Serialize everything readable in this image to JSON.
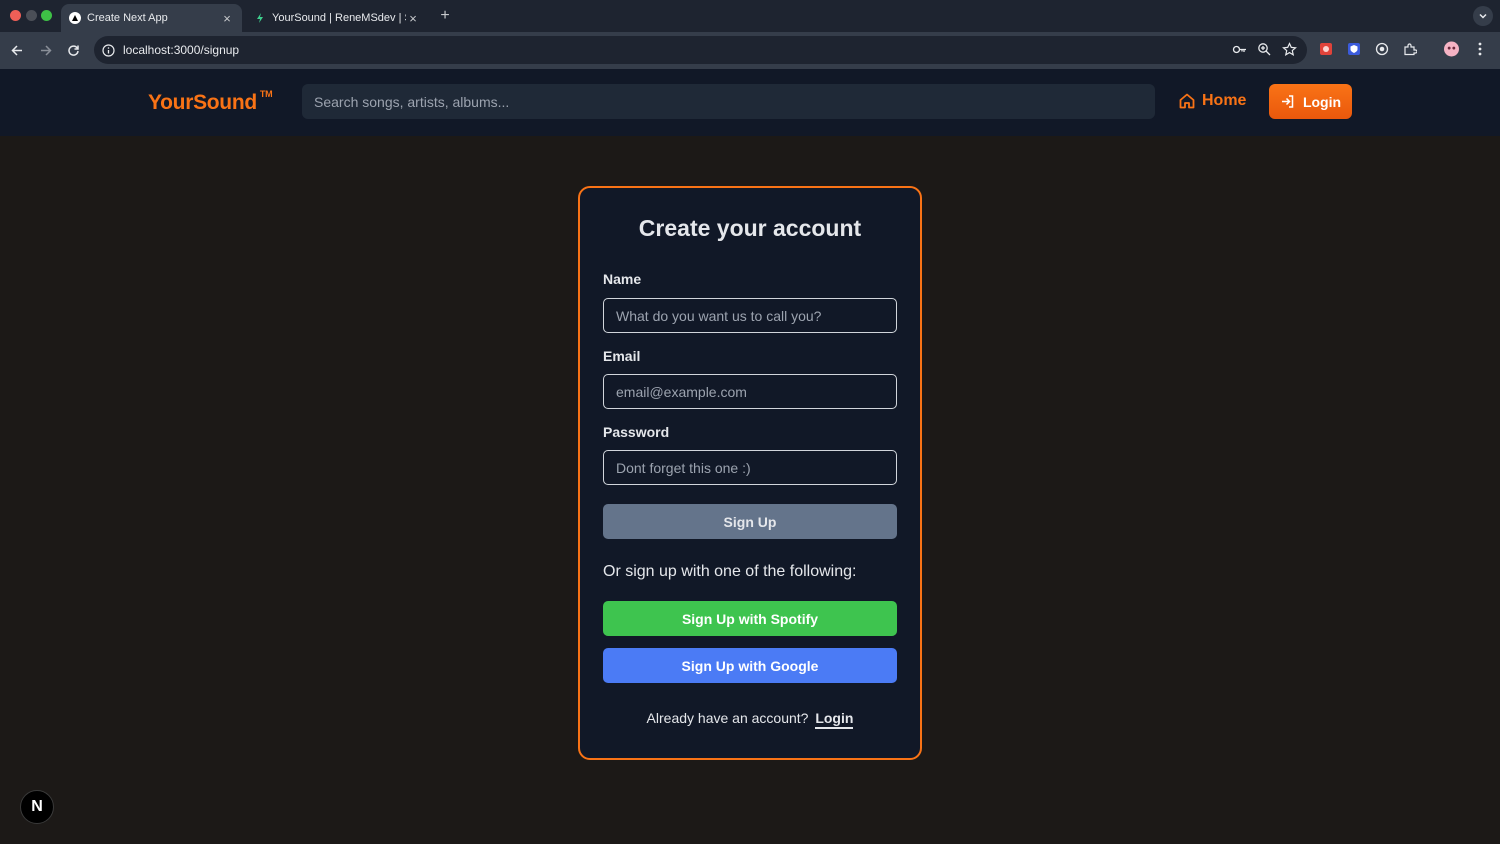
{
  "browser": {
    "tabs": [
      {
        "title": "Create Next App",
        "active": true
      },
      {
        "title": "YourSound | ReneMSdev | Su",
        "active": false
      }
    ],
    "close_glyph": "×",
    "newtab_glyph": "+",
    "url": "localhost:3000/signup"
  },
  "header": {
    "logo": "YourSound",
    "logo_tm": "TM",
    "search_placeholder": "Search songs, artists, albums...",
    "home_label": "Home",
    "login_label": "Login"
  },
  "signup": {
    "title": "Create your account",
    "name_label": "Name",
    "name_placeholder": "What do you want us to call you?",
    "email_label": "Email",
    "email_placeholder": "email@example.com",
    "password_label": "Password",
    "password_placeholder": "Dont forget this one :)",
    "signup_button": "Sign Up",
    "alt_text": "Or sign up with one of the following:",
    "spotify_button": "Sign Up with Spotify",
    "google_button": "Sign Up with Google",
    "footer_prompt": "Already have an account?",
    "footer_link": "Login"
  },
  "next_badge": "N",
  "colors": {
    "accent": "#f97316",
    "page_bg": "#1c1917",
    "header_bg": "#111827",
    "spotify": "#3ec44f",
    "google": "#4b7bf5",
    "signup_btn": "#64748b"
  }
}
